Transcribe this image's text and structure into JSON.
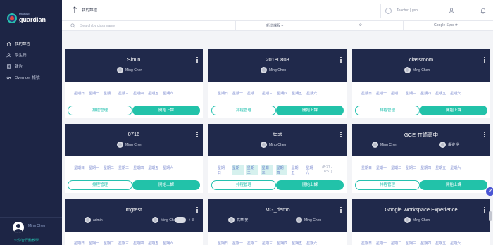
{
  "brand": {
    "small": "mobile",
    "big": "guardian"
  },
  "sidebar": {
    "items": [
      {
        "label": "我的課程",
        "icon": "home-icon",
        "active": true
      },
      {
        "label": "學生們",
        "icon": "students-icon",
        "active": false
      },
      {
        "label": "報告",
        "icon": "report-icon",
        "active": false
      },
      {
        "label": "Overrider 帳號",
        "icon": "key-icon",
        "active": false
      }
    ],
    "user_name": "Ming Chen",
    "school": "公你智行動教學"
  },
  "topbar": {
    "breadcrumb": "我的課程",
    "role": "Teacher | gshl"
  },
  "toolbar": {
    "search_placeholder": "Search by class name",
    "add_label": "新增課程",
    "sync_label": "Google Sync"
  },
  "colors": {
    "sidebar": "#1d2545",
    "card_head": "#20294b",
    "accent": "#22c2a9"
  },
  "buttons": {
    "schedule": "排程管理",
    "start": "開始上課"
  },
  "cards": [
    {
      "title": "Simin",
      "teachers": [
        "Ming Chen"
      ],
      "days": [
        "星期日",
        "星期一",
        "星期二",
        "星期三",
        "星期四",
        "星期五",
        "星期六"
      ],
      "time": ""
    },
    {
      "title": "20180808",
      "teachers": [
        "Ming Chen"
      ],
      "days": [
        "星期日",
        "星期一",
        "星期二",
        "星期三",
        "星期四",
        "星期五",
        "星期六"
      ],
      "time": ""
    },
    {
      "title": "classroom",
      "teachers": [
        "Ming Chen"
      ],
      "days": [
        "星期日",
        "星期一",
        "星期二",
        "星期三",
        "星期四",
        "星期五",
        "星期六"
      ],
      "time": ""
    },
    {
      "title": "0716",
      "teachers": [
        "Ming Chen"
      ],
      "days": [
        "星期日",
        "星期一",
        "星期二",
        "星期三",
        "星期四",
        "星期五",
        "星期六"
      ],
      "time": ""
    },
    {
      "title": "test",
      "teachers": [
        "Ming Chen"
      ],
      "days": [
        "星期日",
        "星期一",
        "星期二",
        "星期三",
        "星期四",
        "星期五",
        "星期六"
      ],
      "time": "(8:37 - 18:51)"
    },
    {
      "title": "GCE 竹崎高中",
      "teachers": [
        "Ming Chen",
        "盧姿 吳"
      ],
      "days": [
        "星期日",
        "星期一",
        "星期二",
        "星期三",
        "星期四",
        "星期五",
        "星期六"
      ],
      "time": ""
    },
    {
      "title": "mgtest",
      "teachers": [
        "admin",
        "Ming Chen"
      ],
      "extra": "+ 3",
      "days": [
        "星期日",
        "星期一",
        "星期二",
        "星期三",
        "星期四",
        "星期五",
        "星期六"
      ],
      "time": ""
    },
    {
      "title": "MG_demo",
      "teachers": [
        "高華 麥",
        "Ming Chen"
      ],
      "days": [
        "星期日",
        "星期一",
        "星期二",
        "星期三",
        "星期四",
        "星期五",
        "星期六"
      ],
      "time": ""
    },
    {
      "title": "Google Workspace Experience",
      "teachers": [
        "Ming Chen"
      ],
      "days": [
        "星期日",
        "星期一",
        "星期二",
        "星期三",
        "星期四",
        "星期五",
        "星期六"
      ],
      "time": ""
    }
  ],
  "help_label": "?"
}
